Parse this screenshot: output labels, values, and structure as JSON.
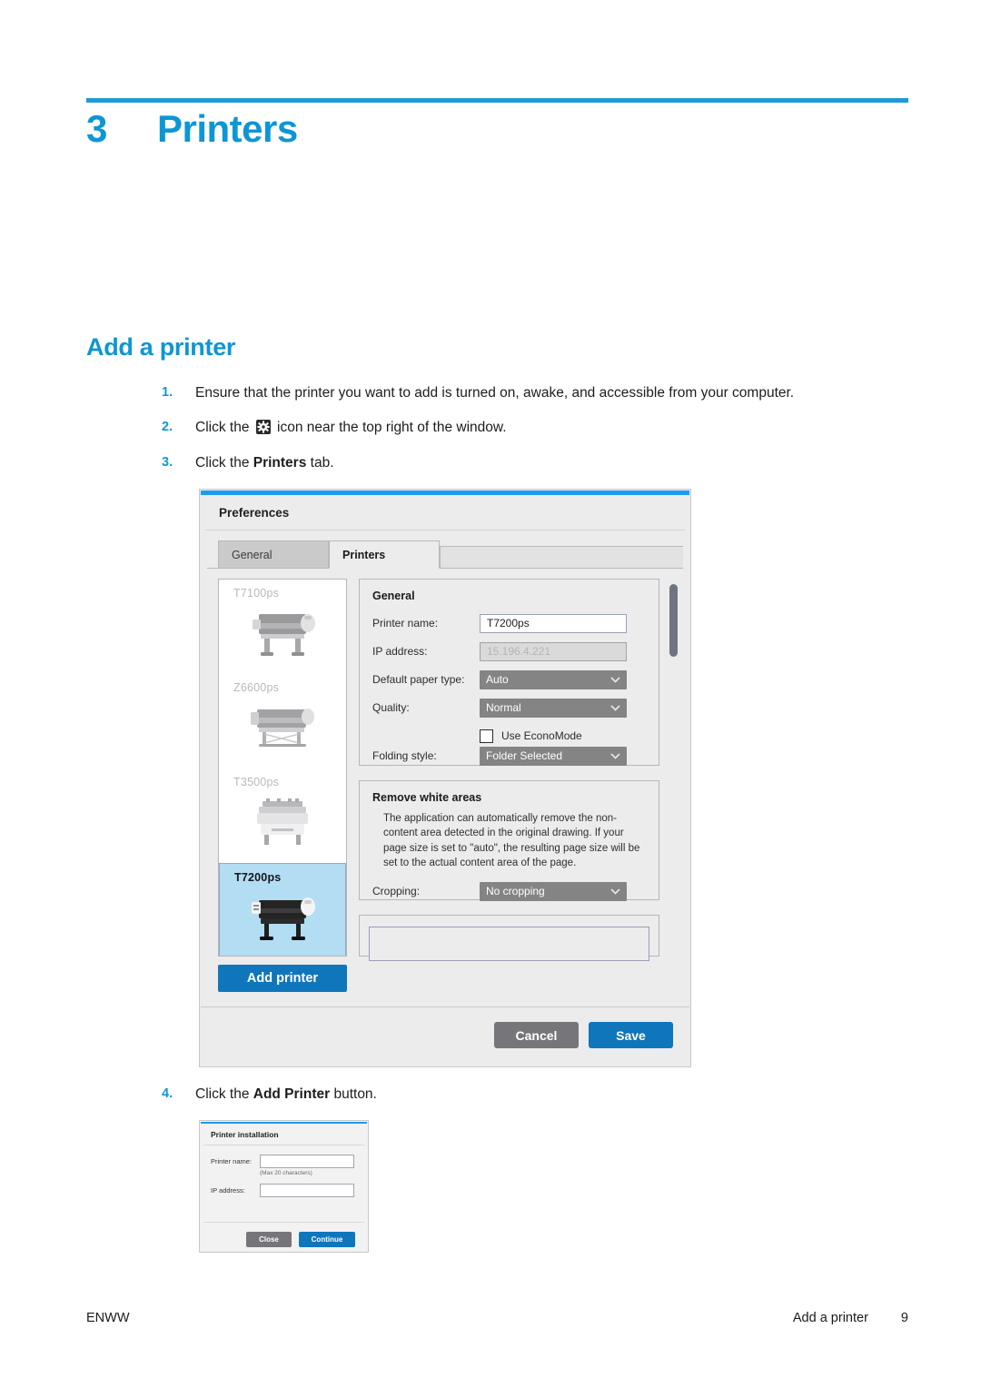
{
  "chapter": {
    "number": "3",
    "title": "Printers"
  },
  "section": {
    "title": "Add a printer"
  },
  "steps": [
    {
      "number": "1.",
      "text_before": "Ensure that the printer you want to add is turned on, awake, and accessible from your computer.",
      "text_after": ""
    },
    {
      "number": "2.",
      "text_before": "Click the ",
      "icon": "gear-icon",
      "text_after": " icon near the top right of the window."
    },
    {
      "number": "3.",
      "text_before": "Click the ",
      "bold": "Printers",
      "text_after": " tab."
    },
    {
      "number": "4.",
      "text_before": "Click the ",
      "bold": "Add Printer",
      "text_after": " button."
    }
  ],
  "preferences_dialog": {
    "title": "Preferences",
    "tabs": [
      {
        "label": "General",
        "active": false
      },
      {
        "label": "Printers",
        "active": true
      }
    ],
    "printer_list": [
      {
        "name": "T7100ps",
        "selected": false
      },
      {
        "name": "Z6600ps",
        "selected": false
      },
      {
        "name": "T3500ps",
        "selected": false
      },
      {
        "name": "T7200ps",
        "selected": true
      }
    ],
    "add_printer_label": "Add printer",
    "general_panel": {
      "title": "General",
      "printer_name_label": "Printer name:",
      "printer_name_value": "T7200ps",
      "ip_address_label": "IP address:",
      "ip_address_value": "15.196.4.221",
      "paper_type_label": "Default paper type:",
      "paper_type_value": "Auto",
      "quality_label": "Quality:",
      "quality_value": "Normal",
      "econo_mode_label": "Use EconoMode",
      "econo_mode_checked": false,
      "folding_style_label": "Folding style:",
      "folding_style_value": "Folder Selected"
    },
    "white_areas_panel": {
      "title": "Remove white areas",
      "description": "The application can automatically remove the non-content area detected in the original drawing. If your page size is set to \"auto\", the resulting page size will be set to the actual content area of the page.",
      "cropping_label": "Cropping:",
      "cropping_value": "No cropping"
    },
    "footer": {
      "cancel_label": "Cancel",
      "save_label": "Save"
    }
  },
  "install_dialog": {
    "title": "Printer installation",
    "printer_name_label": "Printer name:",
    "printer_name_value": "",
    "hint": "(Max 20 characters)",
    "ip_address_label": "IP address:",
    "ip_address_value": "",
    "close_label": "Close",
    "continue_label": "Continue"
  },
  "page_footer": {
    "left": "ENWW",
    "right_title": "Add a printer",
    "page_number": "9"
  },
  "colors": {
    "accent_blue": "#0e96d4",
    "button_blue": "#0f76bc",
    "topbar_blue": "#1c9bf0",
    "selected_row": "#b3ddf2",
    "gray_button": "#76767a",
    "select_gray": "#848484"
  }
}
